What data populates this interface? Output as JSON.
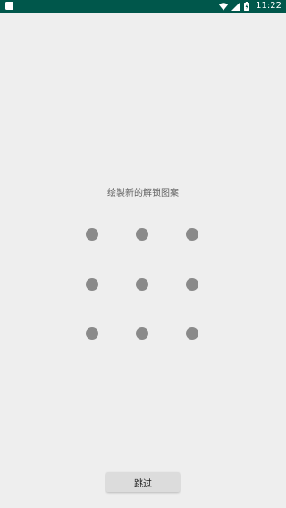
{
  "status_bar": {
    "time": "11:22",
    "background_color": "#00574b",
    "icons": [
      "app-notification-icon",
      "wifi-icon",
      "cell-signal-icon",
      "battery-charging-icon"
    ]
  },
  "pattern_screen": {
    "prompt": "绘製新的解锁图案",
    "dot_color": "#8a8a8a",
    "dot_count": 9,
    "skip_label": "跳过"
  }
}
